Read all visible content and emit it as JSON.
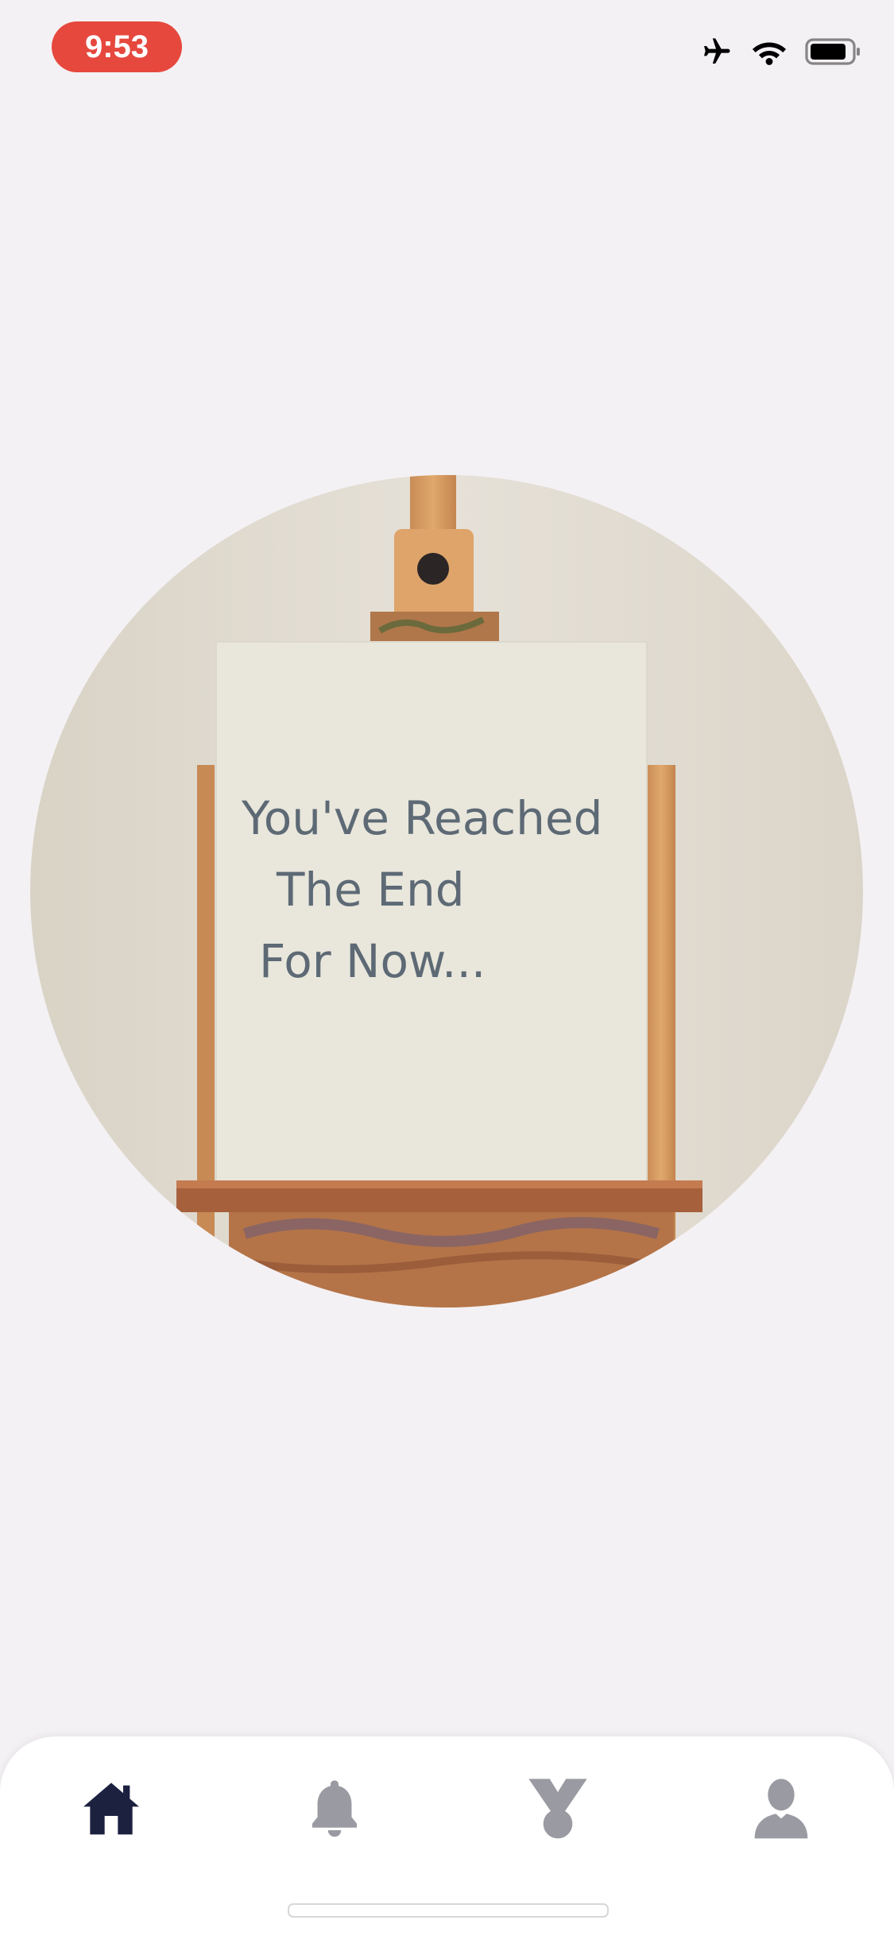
{
  "status_bar": {
    "time": "9:53",
    "time_pill_color": "#e6483d",
    "icons": [
      "airplane-icon",
      "wifi-icon",
      "battery-icon"
    ]
  },
  "hero": {
    "icon": "painting-easel-image",
    "canvas_text": [
      "You've Reached",
      "The End",
      "For Now..."
    ]
  },
  "tab_bar": {
    "tabs": [
      {
        "name": "home",
        "icon": "home-icon",
        "active": true
      },
      {
        "name": "notifications",
        "icon": "bell-icon",
        "active": false
      },
      {
        "name": "achievements",
        "icon": "medal-icon",
        "active": false
      },
      {
        "name": "profile",
        "icon": "user-icon",
        "active": false
      }
    ],
    "active_color": "#1c2140",
    "inactive_color": "#9a9aa2"
  }
}
